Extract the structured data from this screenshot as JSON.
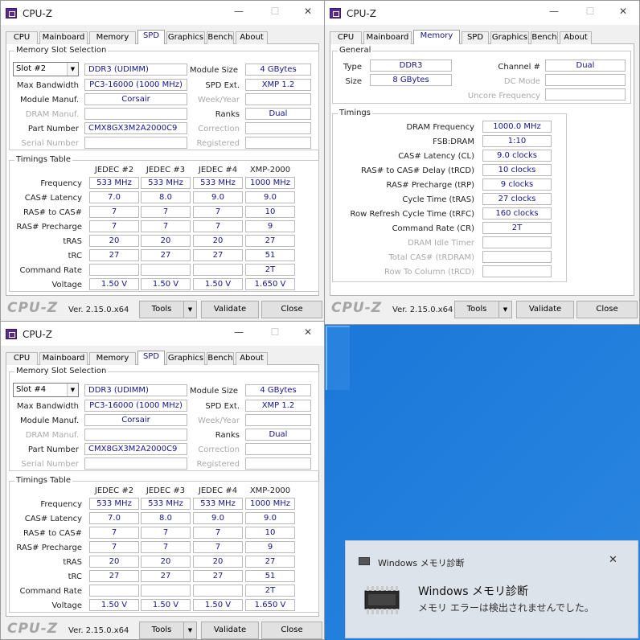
{
  "app_title": "CPU-Z",
  "tabs": [
    "CPU",
    "Mainboard",
    "Memory",
    "SPD",
    "Graphics",
    "Bench",
    "About"
  ],
  "footer": {
    "logo": "CPU-Z",
    "version": "Ver. 2.15.0.x64",
    "tools": "Tools",
    "validate": "Validate",
    "close": "Close"
  },
  "spd_labels": {
    "section": "Memory Slot Selection",
    "module_size": "Module Size",
    "max_bandwidth": "Max Bandwidth",
    "spd_ext": "SPD Ext.",
    "module_manuf": "Module Manuf.",
    "week_year": "Week/Year",
    "dram_manuf": "DRAM Manuf.",
    "ranks": "Ranks",
    "part_number": "Part Number",
    "correction": "Correction",
    "serial_number": "Serial Number",
    "registered": "Registered",
    "timings_table": "Timings Table",
    "frequency": "Frequency",
    "cas_latency": "CAS# Latency",
    "ras_to_cas": "RAS# to CAS#",
    "ras_precharge": "RAS# Precharge",
    "tras": "tRAS",
    "trc": "tRC",
    "command_rate": "Command Rate",
    "voltage": "Voltage"
  },
  "spd_columns": [
    "JEDEC #2",
    "JEDEC #3",
    "JEDEC #4",
    "XMP-2000"
  ],
  "spd_top": {
    "slot": "Slot #2",
    "type": "DDR3 (UDIMM)",
    "module_size": "4 GBytes",
    "max_bandwidth": "PC3-16000 (1000 MHz)",
    "spd_ext": "XMP 1.2",
    "module_manuf": "Corsair",
    "ranks": "Dual",
    "part_number": "CMX8GX3M2A2000C9",
    "rows": {
      "frequency": [
        "533 MHz",
        "533 MHz",
        "533 MHz",
        "1000 MHz"
      ],
      "cas_latency": [
        "7.0",
        "8.0",
        "9.0",
        "9.0"
      ],
      "ras_to_cas": [
        "7",
        "7",
        "7",
        "10"
      ],
      "ras_precharge": [
        "7",
        "7",
        "7",
        "9"
      ],
      "tras": [
        "20",
        "20",
        "20",
        "27"
      ],
      "trc": [
        "27",
        "27",
        "27",
        "51"
      ],
      "command_rate": [
        "",
        "",
        "",
        "2T"
      ],
      "voltage": [
        "1.50 V",
        "1.50 V",
        "1.50 V",
        "1.650 V"
      ]
    }
  },
  "spd_bottom": {
    "slot": "Slot #4",
    "type": "DDR3 (UDIMM)",
    "module_size": "4 GBytes",
    "max_bandwidth": "PC3-16000 (1000 MHz)",
    "spd_ext": "XMP 1.2",
    "module_manuf": "Corsair",
    "ranks": "Dual",
    "part_number": "CMX8GX3M2A2000C9",
    "rows": {
      "frequency": [
        "533 MHz",
        "533 MHz",
        "533 MHz",
        "1000 MHz"
      ],
      "cas_latency": [
        "7.0",
        "8.0",
        "9.0",
        "9.0"
      ],
      "ras_to_cas": [
        "7",
        "7",
        "7",
        "10"
      ],
      "ras_precharge": [
        "7",
        "7",
        "7",
        "9"
      ],
      "tras": [
        "20",
        "20",
        "20",
        "27"
      ],
      "trc": [
        "27",
        "27",
        "27",
        "51"
      ],
      "command_rate": [
        "",
        "",
        "",
        "2T"
      ],
      "voltage": [
        "1.50 V",
        "1.50 V",
        "1.50 V",
        "1.650 V"
      ]
    }
  },
  "memory": {
    "general": "General",
    "type_label": "Type",
    "type": "DDR3",
    "size_label": "Size",
    "size": "8 GBytes",
    "channel_label": "Channel #",
    "channel": "Dual",
    "dc_mode_label": "DC Mode",
    "uncore_label": "Uncore Frequency",
    "timings": "Timings",
    "rows": [
      {
        "label": "DRAM Frequency",
        "value": "1000.0 MHz",
        "enabled": true
      },
      {
        "label": "FSB:DRAM",
        "value": "1:10",
        "enabled": true
      },
      {
        "label": "CAS# Latency (CL)",
        "value": "9.0 clocks",
        "enabled": true
      },
      {
        "label": "RAS# to CAS# Delay (tRCD)",
        "value": "10 clocks",
        "enabled": true
      },
      {
        "label": "RAS# Precharge (tRP)",
        "value": "9 clocks",
        "enabled": true
      },
      {
        "label": "Cycle Time (tRAS)",
        "value": "27 clocks",
        "enabled": true
      },
      {
        "label": "Row Refresh Cycle Time (tRFC)",
        "value": "160 clocks",
        "enabled": true
      },
      {
        "label": "Command Rate (CR)",
        "value": "2T",
        "enabled": true
      },
      {
        "label": "DRAM Idle Timer",
        "value": "",
        "enabled": false
      },
      {
        "label": "Total CAS# (tRDRAM)",
        "value": "",
        "enabled": false
      },
      {
        "label": "Row To Column (tRCD)",
        "value": "",
        "enabled": false
      }
    ]
  },
  "toast": {
    "app": "Windows メモリ診断",
    "title": "Windows メモリ診断",
    "message": "メモリ エラーは検出されませんでした。"
  },
  "colors": {
    "value_text": "#15158a",
    "desktop": "#1976d8"
  }
}
